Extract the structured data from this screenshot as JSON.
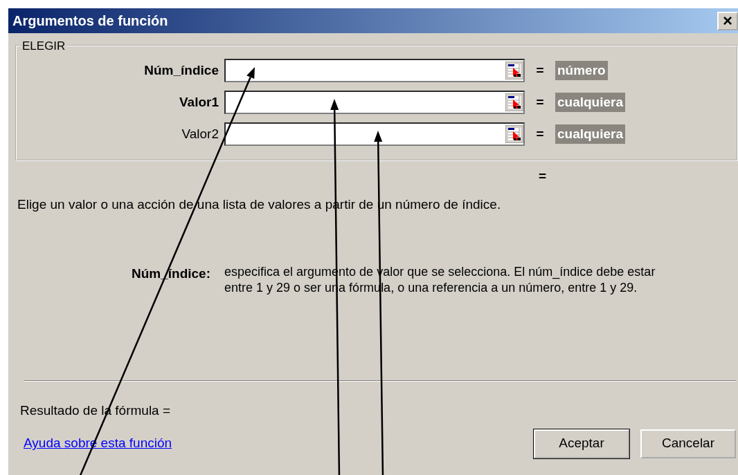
{
  "window": {
    "title": "Argumentos de función",
    "close": "×"
  },
  "function_group": {
    "title": "ELEGIR",
    "arguments": [
      {
        "label": "Núm_índice",
        "required": true,
        "equals": "=",
        "result": "número"
      },
      {
        "label": "Valor1",
        "required": true,
        "equals": "=",
        "result": "cualquiera"
      },
      {
        "label": "Valor2",
        "required": false,
        "equals": "=",
        "result": "cualquiera"
      }
    ]
  },
  "function_result": "=",
  "description": "Elige un valor o una acción de una lista de valores a partir de un número de índice.",
  "argument_help": {
    "label": "Núm_índice:",
    "text": "especifica el argumento de valor que se selecciona. El núm_índice debe estar entre 1 y 29 o ser una fórmula, o una referencia a un número, entre 1 y 29."
  },
  "formula_result": "Resultado de la fórmula =",
  "help_link": "Ayuda sobre esta función",
  "buttons": [
    {
      "label": "Aceptar",
      "default": true
    },
    {
      "label": "Cancelar",
      "default": false
    }
  ],
  "annotations": [
    {
      "kind": "arrow"
    },
    {
      "kind": "arrow"
    },
    {
      "kind": "arrow"
    }
  ]
}
